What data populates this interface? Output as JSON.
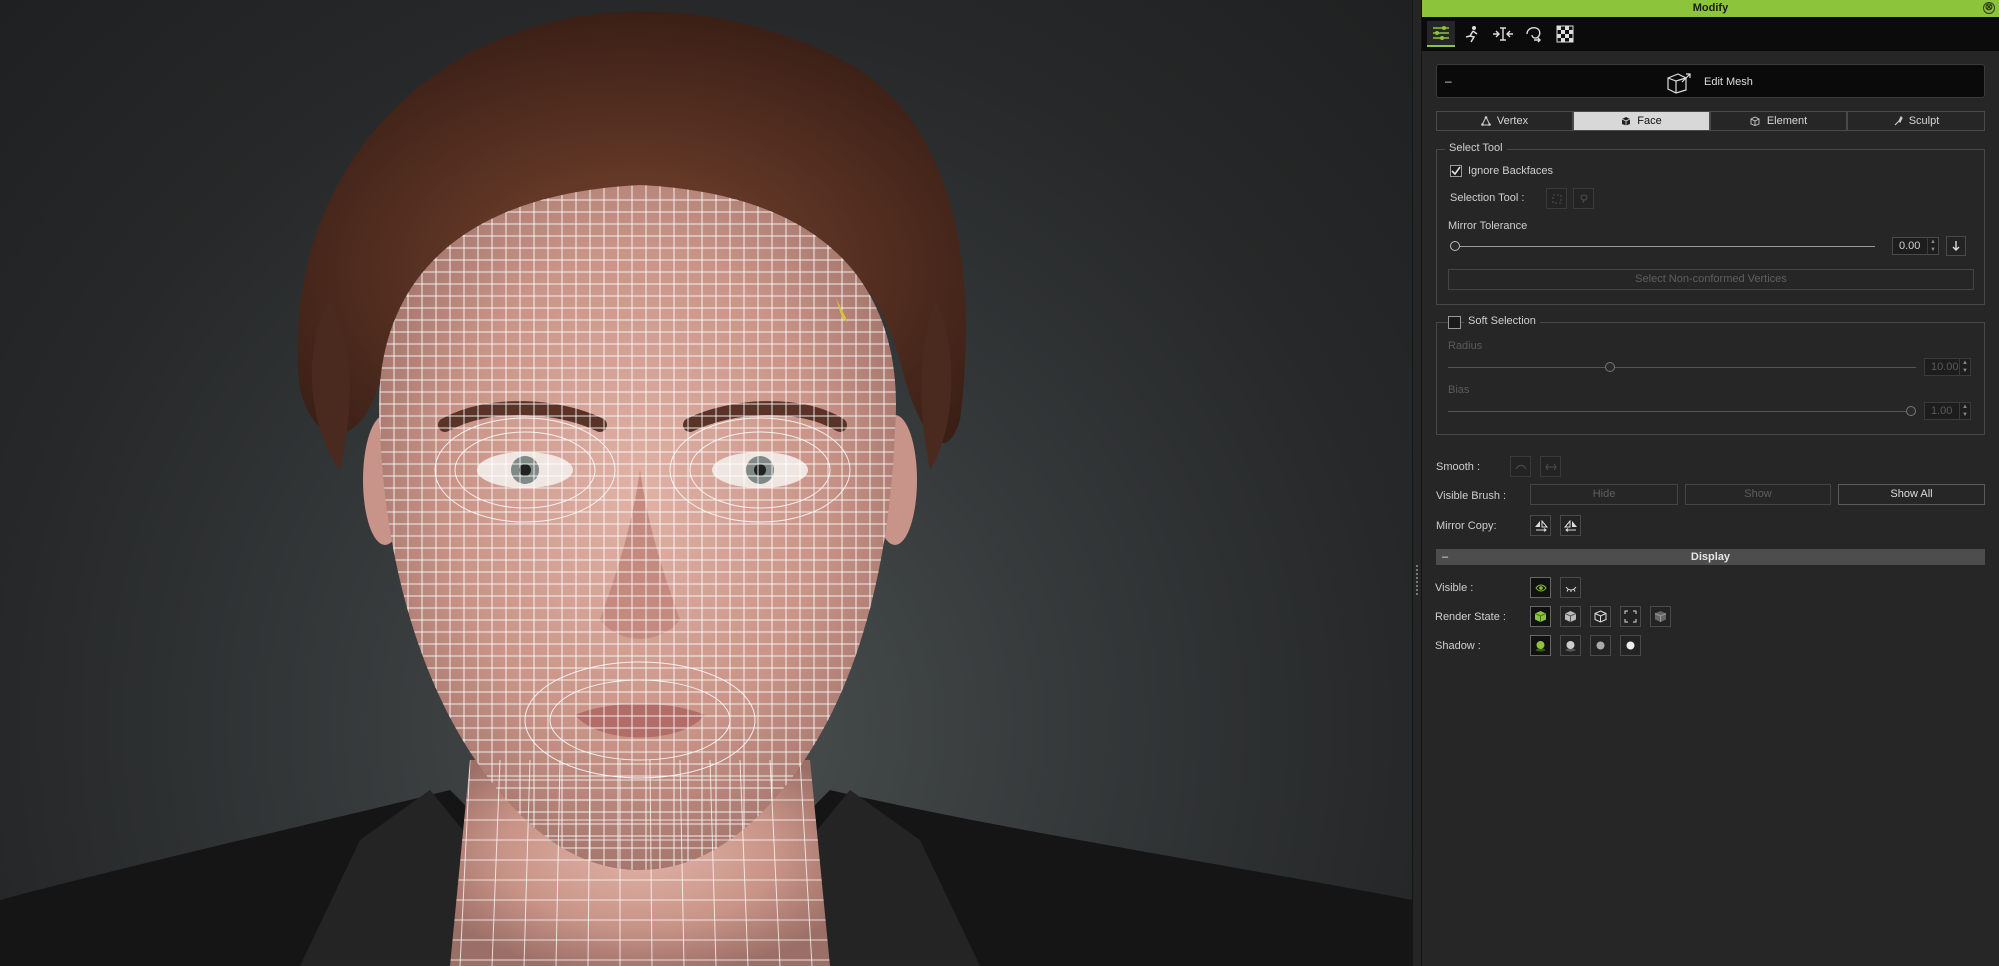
{
  "window": {
    "title": "Modify",
    "close_glyph": "⊗"
  },
  "panel_tabs": [
    {
      "name": "sliders-tab-icon",
      "active": true
    },
    {
      "name": "motion-tab-icon",
      "active": false
    },
    {
      "name": "transform-tab-icon",
      "active": false
    },
    {
      "name": "morph-tab-icon",
      "active": false
    },
    {
      "name": "checker-tab-icon",
      "active": false
    }
  ],
  "edit_mesh": {
    "collapse_glyph": "–",
    "label": "Edit Mesh"
  },
  "mode_tabs": [
    {
      "label": "Vertex",
      "icon": "vertex-icon",
      "active": false
    },
    {
      "label": "Face",
      "icon": "face-icon",
      "active": true
    },
    {
      "label": "Element",
      "icon": "element-icon",
      "active": false
    },
    {
      "label": "Sculpt",
      "icon": "sculpt-icon",
      "active": false
    }
  ],
  "select_tool": {
    "title": "Select Tool",
    "ignore_backfaces": {
      "label": "Ignore Backfaces",
      "checked": true
    },
    "selection_tool_label": "Selection Tool :",
    "mirror_tolerance_label": "Mirror Tolerance",
    "mirror_tolerance_value": "0.00",
    "mirror_tolerance_level": 0.0,
    "select_nonconformed_label": "Select Non-conformed Vertices"
  },
  "soft_selection": {
    "label": "Soft Selection",
    "checked": false,
    "radius_label": "Radius",
    "radius_value": "10.00",
    "radius_level": 0.33,
    "bias_label": "Bias",
    "bias_value": "1.00",
    "bias_level": 1.0
  },
  "smooth_label": "Smooth :",
  "visible_brush": {
    "label": "Visible Brush :",
    "hide": "Hide",
    "show": "Show",
    "show_all": "Show All"
  },
  "mirror_copy_label": "Mirror Copy:",
  "display": {
    "collapse_glyph": "–",
    "title": "Display",
    "visible_label": "Visible :",
    "render_state_label": "Render State :",
    "shadow_label": "Shadow :"
  },
  "colors": {
    "accent": "#8cc43c",
    "panel_bg": "#262626",
    "wireframe": "#ffffff"
  }
}
